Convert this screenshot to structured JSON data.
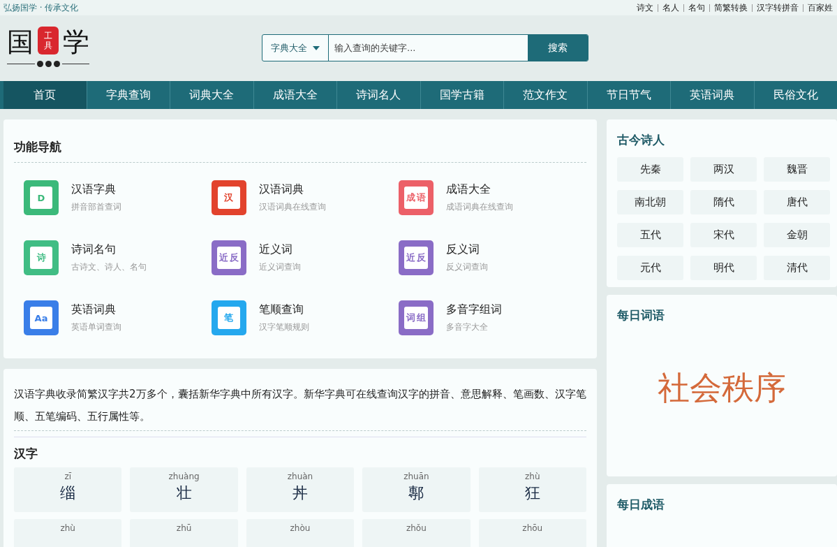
{
  "top_bar": {
    "slogan": "弘扬国学 · 传承文化",
    "links": [
      "诗文",
      "名人",
      "名句",
      "简繁转换",
      "汉字转拼音",
      "百家姓"
    ]
  },
  "logo": {
    "left_char": "国",
    "seal_chars": [
      "工",
      "具"
    ],
    "right_char": "学"
  },
  "search": {
    "category": "字典大全",
    "placeholder": "输入查询的关键字...",
    "button": "搜索"
  },
  "nav": [
    {
      "label": "首页",
      "selected": true
    },
    {
      "label": "字典查询",
      "selected": false
    },
    {
      "label": "词典大全",
      "selected": false
    },
    {
      "label": "成语大全",
      "selected": false
    },
    {
      "label": "诗词名人",
      "selected": false
    },
    {
      "label": "国学古籍",
      "selected": false
    },
    {
      "label": "范文作文",
      "selected": false
    },
    {
      "label": "节日节气",
      "selected": false
    },
    {
      "label": "英语词典",
      "selected": false
    },
    {
      "label": "民俗文化",
      "selected": false
    }
  ],
  "features": {
    "title": "功能导航",
    "items": [
      {
        "title": "汉语字典",
        "subtitle": "拼音部首查词",
        "color": "#3cb97a",
        "icon_text": [
          "D"
        ]
      },
      {
        "title": "汉语词典",
        "subtitle": "汉语词典在线查询",
        "color": "#e2432d",
        "icon_text": [
          "汉"
        ]
      },
      {
        "title": "成语大全",
        "subtitle": "成语词典在线查询",
        "color": "#ec6068",
        "icon_text": [
          "成",
          "语"
        ]
      },
      {
        "title": "诗词名句",
        "subtitle": "古诗文、诗人、名句",
        "color": "#41bd84",
        "icon_text": [
          "诗"
        ]
      },
      {
        "title": "近义词",
        "subtitle": "近义词查询",
        "color": "#8a6cc6",
        "icon_text": [
          "近",
          "反"
        ]
      },
      {
        "title": "反义词",
        "subtitle": "反义词查询",
        "color": "#8a6cc6",
        "icon_text": [
          "近",
          "反"
        ]
      },
      {
        "title": "英语词典",
        "subtitle": "英语单词查询",
        "color": "#3a7ee8",
        "icon_text": [
          "Aa"
        ]
      },
      {
        "title": "笔顺查询",
        "subtitle": "汉字笔顺规则",
        "color": "#25a8ee",
        "icon_text": [
          "笔"
        ]
      },
      {
        "title": "多音字组词",
        "subtitle": "多音字大全",
        "color": "#8a6cc6",
        "icon_text": [
          "词",
          "组"
        ]
      }
    ]
  },
  "intro": "汉语字典收录简繁汉字共2万多个，囊括新华字典中所有汉字。新华字典可在线查询汉字的拼音、意思解释、笔画数、汉字笔顺、五笔编码、五行属性等。",
  "hanzi": {
    "title": "汉字",
    "cells": [
      {
        "pinyin": "zī",
        "char": "缁"
      },
      {
        "pinyin": "zhuàng",
        "char": "壮"
      },
      {
        "pinyin": "zhuàn",
        "char": "丼"
      },
      {
        "pinyin": "zhuān",
        "char": "鄟"
      },
      {
        "pinyin": "zhù",
        "char": "狂"
      },
      {
        "pinyin": "zhù"
      },
      {
        "pinyin": "zhū"
      },
      {
        "pinyin": "zhòu"
      },
      {
        "pinyin": "zhǒu"
      },
      {
        "pinyin": "zhōu"
      }
    ]
  },
  "poets": {
    "title": "古今诗人",
    "dynasties": [
      "先秦",
      "两汉",
      "魏晋",
      "南北朝",
      "隋代",
      "唐代",
      "五代",
      "宋代",
      "金朝",
      "元代",
      "明代",
      "清代"
    ]
  },
  "daily_word": {
    "title": "每日词语",
    "word": "社会秩序"
  },
  "daily_idiom": {
    "title": "每日成语"
  }
}
